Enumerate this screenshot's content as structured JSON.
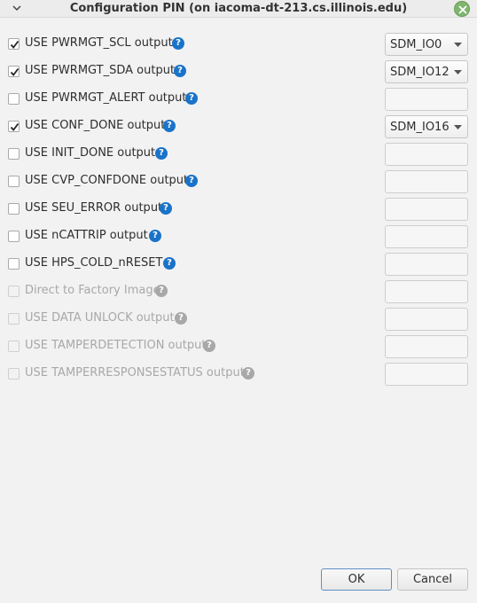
{
  "window": {
    "title": "Configuration PIN (on iacoma-dt-213.cs.illinois.edu)",
    "close_icon": "close-icon",
    "menu_icon": "chevron-down-icon"
  },
  "options": [
    {
      "label": "USE PWRMGT_SCL output",
      "checked": true,
      "enabled": true,
      "value": "SDM_IO0"
    },
    {
      "label": "USE PWRMGT_SDA output",
      "checked": true,
      "enabled": true,
      "value": "SDM_IO12"
    },
    {
      "label": "USE PWRMGT_ALERT output",
      "checked": false,
      "enabled": true,
      "value": ""
    },
    {
      "label": "USE CONF_DONE output",
      "checked": true,
      "enabled": true,
      "value": "SDM_IO16"
    },
    {
      "label": "USE INIT_DONE output",
      "checked": false,
      "enabled": true,
      "value": ""
    },
    {
      "label": "USE CVP_CONFDONE output",
      "checked": false,
      "enabled": true,
      "value": ""
    },
    {
      "label": "USE SEU_ERROR output",
      "checked": false,
      "enabled": true,
      "value": ""
    },
    {
      "label": "USE nCATTRIP output",
      "checked": false,
      "enabled": true,
      "value": ""
    },
    {
      "label": "USE HPS_COLD_nRESET",
      "checked": false,
      "enabled": true,
      "value": ""
    },
    {
      "label": "Direct to Factory Image",
      "checked": false,
      "enabled": false,
      "value": ""
    },
    {
      "label": "USE DATA UNLOCK output",
      "checked": false,
      "enabled": false,
      "value": ""
    },
    {
      "label": "USE TAMPERDETECTION output",
      "checked": false,
      "enabled": false,
      "value": ""
    },
    {
      "label": "USE TAMPERRESPONSESTATUS output",
      "checked": false,
      "enabled": false,
      "value": ""
    }
  ],
  "help_glyph": "?",
  "buttons": {
    "ok": "OK",
    "cancel": "Cancel"
  },
  "colors": {
    "help_icon": "#1a73c8",
    "close_button": "#7fb56e",
    "ok_border": "#5f8fc4"
  }
}
